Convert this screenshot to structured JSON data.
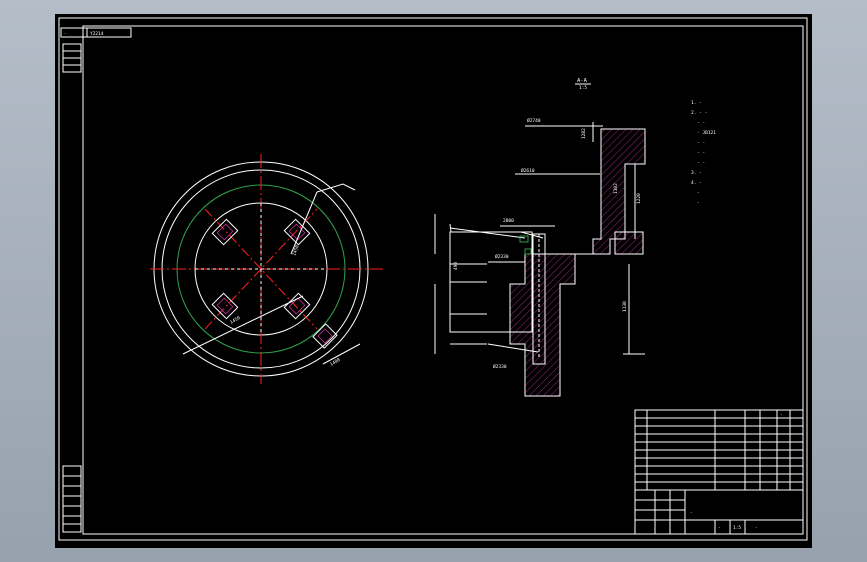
{
  "colors": {
    "background": "#000000",
    "lines": "#ffffff",
    "center_lines": "#ff2020",
    "circle_green": "#2fa14a",
    "hatch": "#ff3cc8"
  },
  "top_label": {
    "code": "-",
    "name": "Y2214"
  },
  "section_label": {
    "name": "A-A",
    "scale": "1:5"
  },
  "notes": [
    "1. -",
    "2. - -",
    "- -",
    "- JB121",
    "- -",
    "- -",
    "- -",
    "3. -",
    "4. -",
    "-",
    "-"
  ],
  "dims_section": [
    "Ø2740",
    "Ø2610",
    "1282",
    "2800",
    "Ø2330",
    "490",
    "Ø2330",
    "1220",
    "1130",
    "1102"
  ],
  "dims_plan": [
    "1450",
    "1450",
    "1400"
  ],
  "title_block": {
    "drawing_no": "-",
    "scale": "1:5",
    "sheet": "-",
    "material": "-",
    "name": "-"
  }
}
